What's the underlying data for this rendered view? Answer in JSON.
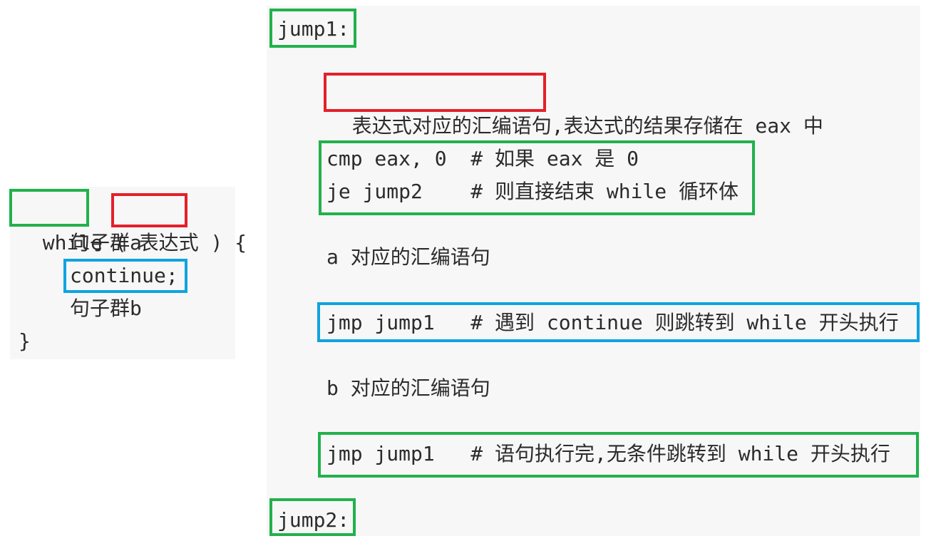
{
  "colors": {
    "green": "#22b14c",
    "red": "#e3202a",
    "blue": "#10a3e0",
    "panel_bg": "#f7f7f7",
    "text": "#2b2b2b"
  },
  "c_code": {
    "while_kw": "while",
    "open_paren": "(",
    "expr": "表达式",
    "close_paren_brace": ") {",
    "stmt_a": "句子群a",
    "continue_stmt": "continue;",
    "stmt_b": "句子群b",
    "close_brace": "}"
  },
  "asm_code": {
    "label1": "jump1:",
    "expr_asm": "表达式对应的汇编语句,",
    "expr_asm_rest": "表达式的结果存储在 eax 中",
    "cmp_line": "cmp eax, 0  # 如果 eax 是 0",
    "je_line": "je jump2    # 则直接结束 while 循环体",
    "a_asm": "a 对应的汇编语句",
    "continue_jmp": "jmp jump1   # 遇到 continue 则跳转到 while 开头执行",
    "b_asm": "b 对应的汇编语句",
    "loop_jmp": "jmp jump1   # 语句执行完,无条件跳转到 while 开头执行",
    "label2": "jump2:"
  }
}
